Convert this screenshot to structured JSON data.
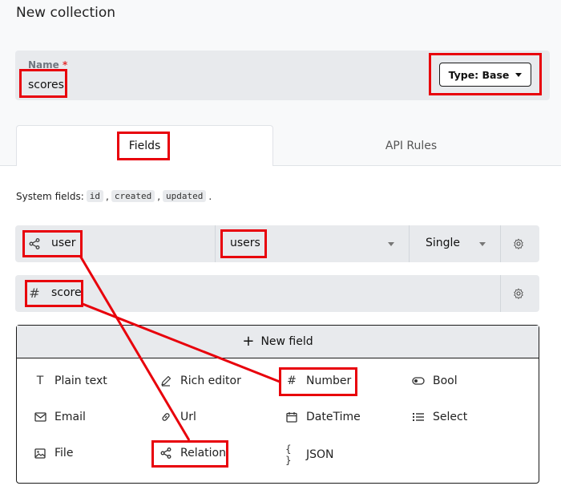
{
  "page": {
    "title": "New collection"
  },
  "name_field": {
    "label": "Name",
    "required_mark": "*",
    "value": "scores"
  },
  "type_button": {
    "label": "Type: Base"
  },
  "tabs": [
    {
      "label": "Fields",
      "active": true
    },
    {
      "label": "API Rules",
      "active": false
    }
  ],
  "system_fields": {
    "prefix": "System fields:",
    "items": [
      "id",
      "created",
      "updated"
    ],
    "separator": ",",
    "suffix": "."
  },
  "fields": [
    {
      "icon": "relation-icon",
      "name": "user",
      "collection": "users",
      "mode": "Single"
    },
    {
      "icon": "hash-icon",
      "name": "score"
    }
  ],
  "new_field": {
    "label": "New field",
    "options": [
      {
        "icon": "text-icon",
        "label": "Plain text"
      },
      {
        "icon": "pen-icon",
        "label": "Rich editor"
      },
      {
        "icon": "hash-icon",
        "label": "Number"
      },
      {
        "icon": "toggle-icon",
        "label": "Bool"
      },
      {
        "icon": "mail-icon",
        "label": "Email"
      },
      {
        "icon": "link-icon",
        "label": "Url"
      },
      {
        "icon": "calendar-icon",
        "label": "DateTime"
      },
      {
        "icon": "list-icon",
        "label": "Select"
      },
      {
        "icon": "image-icon",
        "label": "File"
      },
      {
        "icon": "relation-icon",
        "label": "Relation"
      },
      {
        "icon": "braces-icon",
        "label": "JSON"
      }
    ]
  },
  "colors": {
    "highlight": "#e8000b",
    "panel": "#e8eaed",
    "required": "#e12d2d"
  }
}
